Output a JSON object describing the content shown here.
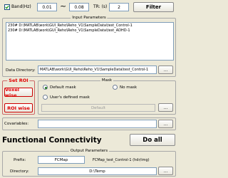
{
  "band": {
    "checkbox_label": "Band(Hz)",
    "checked": true,
    "low_value": "0.01",
    "separator": "~",
    "high_value": "0.08",
    "tr_label": "TR: (s)",
    "tr_value": "2",
    "filter_label": "Filter"
  },
  "input_parameters": {
    "title": "Input Parameters",
    "list_items": [
      "230# D:\\MATLAB\\work\\GUI_Reho\\Reho_V1\\SampleData\\test_Control-1",
      "230# D:\\MATLAB\\work\\GUI_Reho\\Reho_V1\\SampleData\\test_ADHD-1"
    ],
    "data_directory_label": "Data Directory:",
    "data_directory_value": "MATLAB\\work\\GUI_Reho\\Reho_V1\\SampleData\\test_Control-1",
    "browse_label": "..."
  },
  "set_roi": {
    "title": "Set ROI",
    "voxel_wise_label": "Voxel wise",
    "roi_wise_label": "ROI wise"
  },
  "mask": {
    "title": "Mask",
    "default_mask_label": "Default mask",
    "no_mask_label": "No mask",
    "user_mask_label": "User's defined mask",
    "selected": "default",
    "default_button_label": "Default",
    "browse_label": "..."
  },
  "covariables": {
    "label": "Covariables:",
    "value": "",
    "browse_label": "..."
  },
  "main": {
    "title": "Functional Connectivity",
    "do_all_label": "Do all"
  },
  "output_parameters": {
    "title": "Output Parameters",
    "prefix_label": "Prefix:",
    "prefix_value": "FCMap",
    "prefix_example": "FCMap_test_Control-1 (hdr/img)",
    "directory_label": "Directory:",
    "directory_value": "D:\\Temp",
    "browse_label": "..."
  }
}
